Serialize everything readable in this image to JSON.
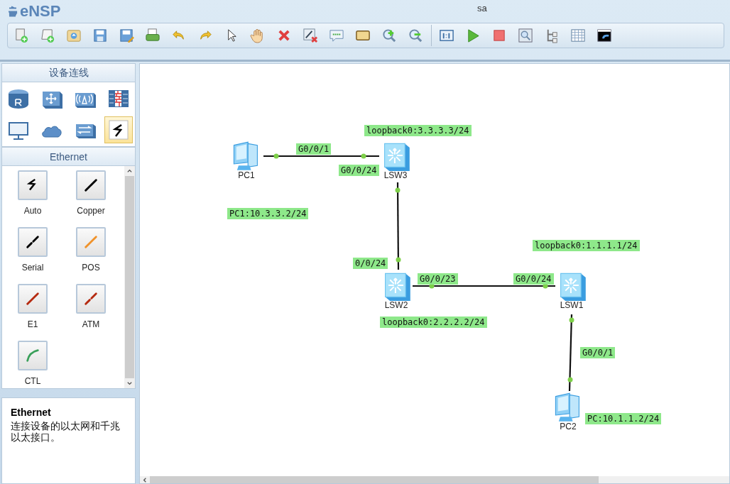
{
  "app": {
    "name": "eNSP"
  },
  "window": {
    "title": "sa"
  },
  "sidebar": {
    "title": "设备连线",
    "categories": [
      {
        "kind": "router",
        "selected": false
      },
      {
        "kind": "switch",
        "selected": false
      },
      {
        "kind": "wireless",
        "selected": false
      },
      {
        "kind": "firewall",
        "selected": false
      },
      {
        "kind": "terminal",
        "selected": false
      },
      {
        "kind": "cloud",
        "selected": false
      },
      {
        "kind": "hub",
        "selected": false
      },
      {
        "kind": "cable",
        "selected": true
      }
    ],
    "section": "Ethernet",
    "cables": [
      {
        "label": "Auto",
        "kind": "auto"
      },
      {
        "label": "Copper",
        "kind": "copper"
      },
      {
        "label": "Serial",
        "kind": "serial"
      },
      {
        "label": "POS",
        "kind": "pos"
      },
      {
        "label": "E1",
        "kind": "e1"
      },
      {
        "label": "ATM",
        "kind": "atm"
      },
      {
        "label": "CTL",
        "kind": "ctl"
      }
    ],
    "info": {
      "title": "Ethernet",
      "text": "连接设备的以太网和千兆以太接口。"
    }
  },
  "topology": {
    "nodes": [
      {
        "name": "PC1",
        "kind": "pc"
      },
      {
        "name": "LSW3",
        "kind": "switch"
      },
      {
        "name": "LSW2",
        "kind": "switch"
      },
      {
        "name": "LSW1",
        "kind": "switch"
      },
      {
        "name": "PC2",
        "kind": "pc"
      }
    ],
    "labels": [
      "loopback0:3.3.3.3/24",
      "G0/0/1",
      "G0/0/24",
      "PC1:10.3.3.2/24",
      "loopback0:1.1.1.1/24",
      "0/0/24",
      "G0/0/23",
      "G0/0/24",
      "loopback0:2.2.2.2/24",
      "G0/0/1",
      "PC:10.1.1.2/24"
    ]
  }
}
